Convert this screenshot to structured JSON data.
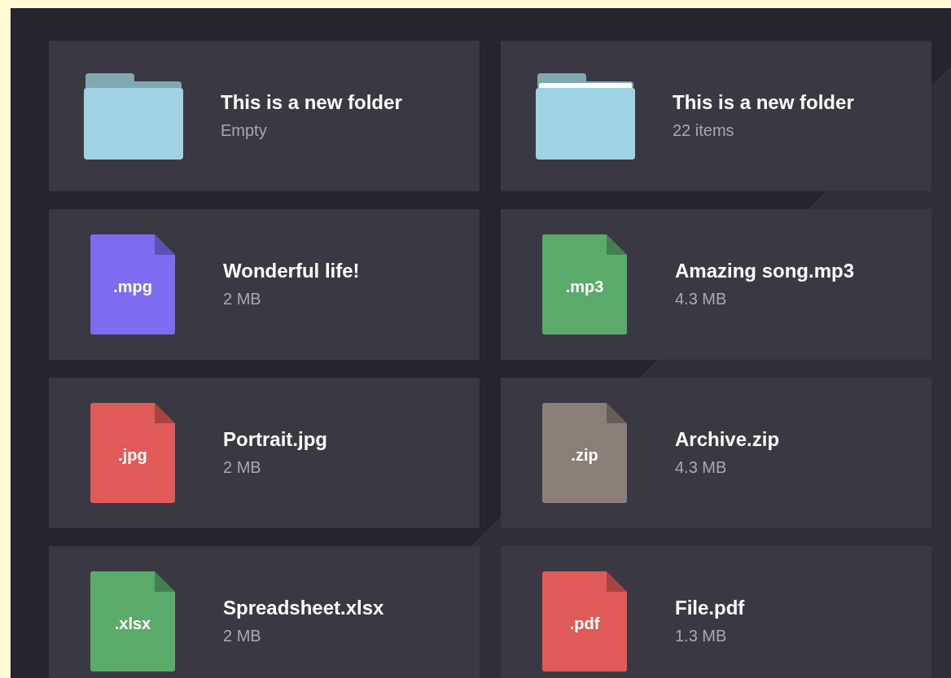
{
  "items": [
    {
      "kind": "folder",
      "empty": true,
      "color": "#9fd3e3",
      "name": "This is a new folder",
      "detail": "Empty"
    },
    {
      "kind": "folder",
      "empty": false,
      "color": "#9fd3e3",
      "name": "This is a new folder",
      "detail": "22 items"
    },
    {
      "kind": "file",
      "color": "#7b6cf0",
      "extension": ".mpg",
      "name": "Wonderful life!",
      "detail": "2 MB"
    },
    {
      "kind": "file",
      "color": "#5aaa6a",
      "extension": ".mp3",
      "name": "Amazing song.mp3",
      "detail": "4.3 MB"
    },
    {
      "kind": "file",
      "color": "#e05a57",
      "extension": ".jpg",
      "name": "Portrait.jpg",
      "detail": "2 MB"
    },
    {
      "kind": "file",
      "color": "#8a7e76",
      "extension": ".zip",
      "name": "Archive.zip",
      "detail": "4.3 MB"
    },
    {
      "kind": "file",
      "color": "#5aaa6a",
      "extension": ".xlsx",
      "name": "Spreadsheet.xlsx",
      "detail": "2 MB"
    },
    {
      "kind": "file",
      "color": "#e05a57",
      "extension": ".pdf",
      "name": "File.pdf",
      "detail": "1.3 MB"
    }
  ]
}
